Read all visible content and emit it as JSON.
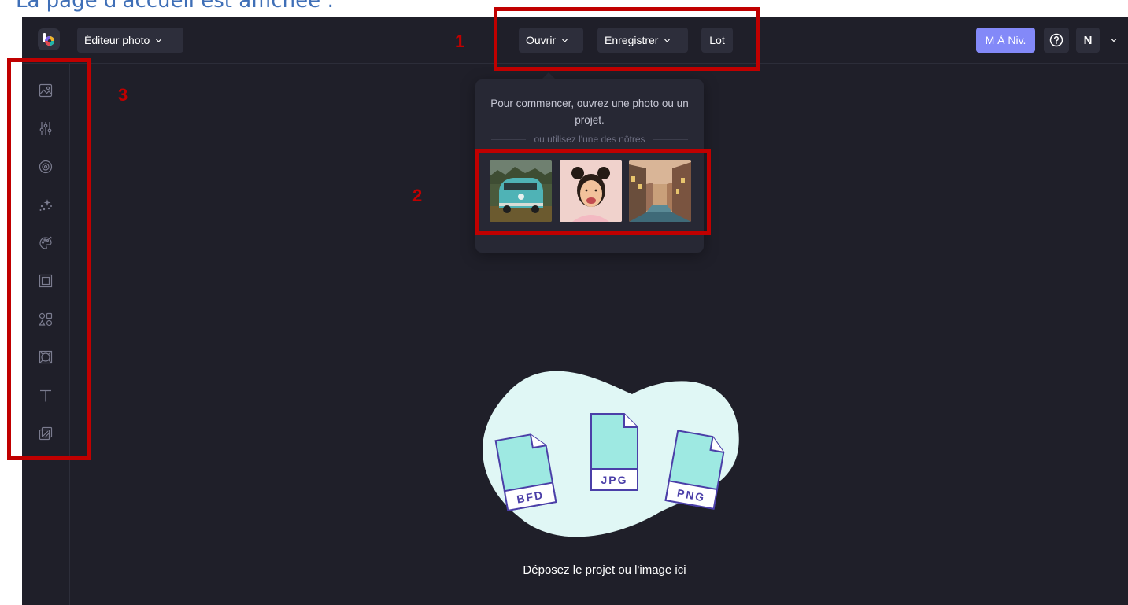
{
  "page_heading": "La page d'accueil est affichée :",
  "topbar": {
    "editor_select": "Éditeur photo",
    "open_button": "Ouvrir",
    "save_button": "Enregistrer",
    "batch_button": "Lot",
    "upgrade_button": "M À Niv.",
    "avatar_initial": "N"
  },
  "sidebar": {
    "tools": [
      "image-icon",
      "adjust-sliders-icon",
      "eye-icon",
      "sparkles-icon",
      "palette-icon",
      "frame-icon",
      "shapes-icon",
      "texture-icon",
      "text-icon",
      "overlay-icon"
    ]
  },
  "popover": {
    "message": "Pour commencer, ouvrez une photo ou un projet.",
    "divider": "ou utilisez l'une des nôtres",
    "samples": [
      "van-photo",
      "portrait-photo",
      "canal-city-photo"
    ]
  },
  "dropzone": {
    "files": [
      "BFD",
      "JPG",
      "PNG"
    ],
    "label": "Déposez le projet ou l'image ici"
  },
  "annotations": [
    "1",
    "2",
    "3"
  ],
  "colors": {
    "background": "#1f1f29",
    "panel": "#2d2e3b",
    "accent": "#8389f8",
    "annotation": "#c00000",
    "drop_blob": "#e0f7f5",
    "file_fill": "#9ee9e2",
    "file_stroke": "#4b3fa8"
  }
}
